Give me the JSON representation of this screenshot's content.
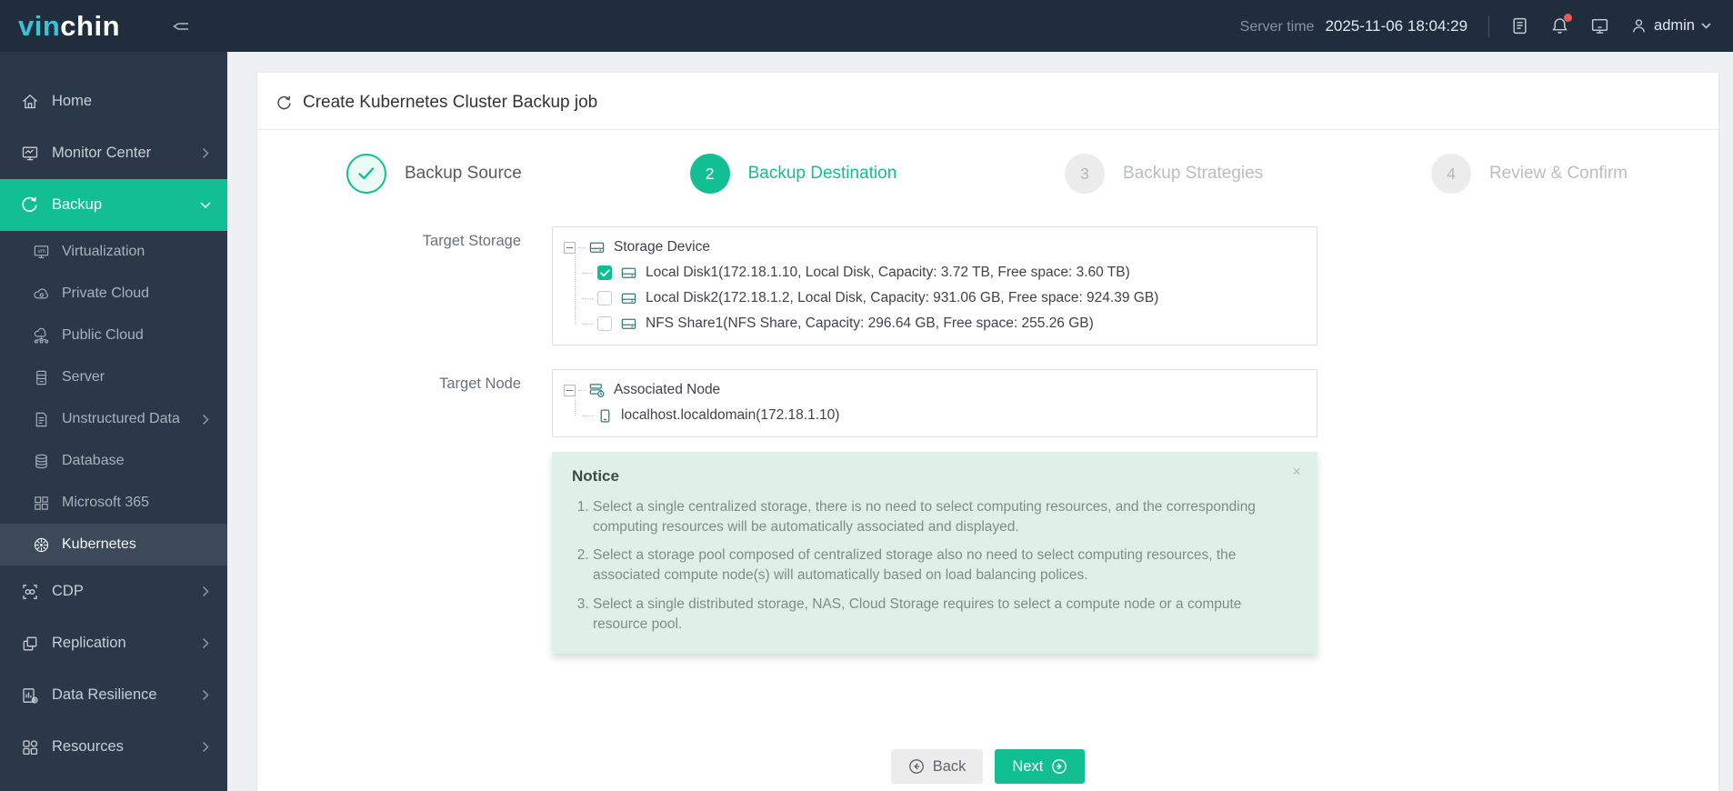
{
  "topbar": {
    "logo_prefix": "vin",
    "logo_suffix": "chin",
    "server_time_label": "Server time",
    "server_time_value": "2025-11-06 18:04:29",
    "username": "admin"
  },
  "sidebar": {
    "items": [
      {
        "label": "Home"
      },
      {
        "label": "Monitor Center"
      },
      {
        "label": "Backup"
      },
      {
        "label": "Virtualization"
      },
      {
        "label": "Private Cloud"
      },
      {
        "label": "Public Cloud"
      },
      {
        "label": "Server"
      },
      {
        "label": "Unstructured Data"
      },
      {
        "label": "Database"
      },
      {
        "label": "Microsoft 365"
      },
      {
        "label": "Kubernetes"
      },
      {
        "label": "CDP"
      },
      {
        "label": "Replication"
      },
      {
        "label": "Data Resilience"
      },
      {
        "label": "Resources"
      }
    ]
  },
  "page": {
    "title": "Create Kubernetes Cluster Backup job"
  },
  "wizard": {
    "steps": [
      {
        "number": "1",
        "label": "Backup Source",
        "state": "done"
      },
      {
        "number": "2",
        "label": "Backup Destination",
        "state": "current"
      },
      {
        "number": "3",
        "label": "Backup Strategies",
        "state": "pending"
      },
      {
        "number": "4",
        "label": "Review & Confirm",
        "state": "pending"
      }
    ]
  },
  "form": {
    "target_storage_label": "Target Storage",
    "target_node_label": "Target Node",
    "storage_tree": {
      "root": "Storage Device",
      "children": [
        {
          "label": "Local Disk1(172.18.1.10, Local Disk, Capacity: 3.72 TB, Free space: 3.60 TB)",
          "checked": true
        },
        {
          "label": "Local Disk2(172.18.1.2, Local Disk, Capacity: 931.06 GB, Free space: 924.39 GB)",
          "checked": false
        },
        {
          "label": "NFS Share1(NFS Share, Capacity: 296.64 GB, Free space: 255.26 GB)",
          "checked": false
        }
      ]
    },
    "node_tree": {
      "root": "Associated Node",
      "children": [
        {
          "label": "localhost.localdomain(172.18.1.10)"
        }
      ]
    }
  },
  "notice": {
    "title": "Notice",
    "close_label": "×",
    "items": [
      "Select a single centralized storage, there is no need to select computing resources, and the corresponding computing resources will be automatically associated and displayed.",
      "Select a storage pool composed of centralized storage also no need to select computing resources, the associated compute node(s) will automatically based on load balancing polices.",
      "Select a single distributed storage, NAS, Cloud Storage requires to select a compute node or a compute resource pool."
    ]
  },
  "footer": {
    "back_label": "Back",
    "next_label": "Next"
  },
  "colors": {
    "accent_green": "#12bf92",
    "topbar_bg": "#1f2d3d",
    "sidebar_bg": "#2b3848",
    "sidebar_active_sub_bg": "#3c4958",
    "logo_cyan": "#38c4d8",
    "notice_bg": "#def0e8",
    "badge_red": "#f0584f",
    "tree_icon_teal": "#2a7f80"
  }
}
